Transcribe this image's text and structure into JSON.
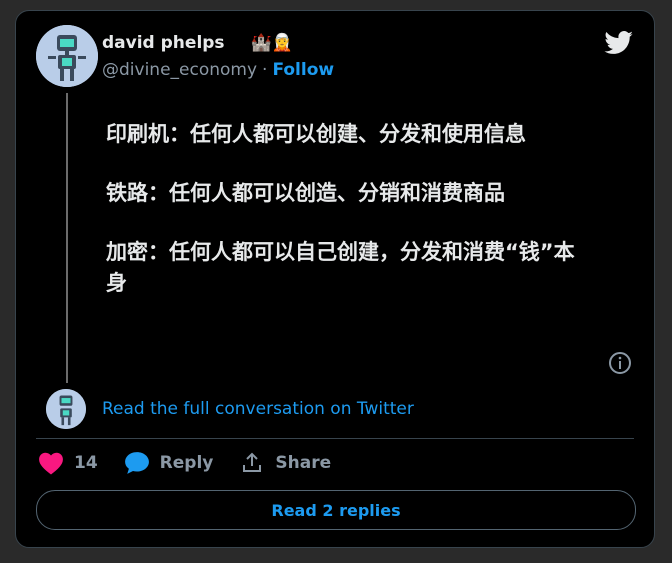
{
  "author": {
    "name": "david phelps",
    "emojis": "🐮🏰🧝",
    "handle": "@divine_economy",
    "separator": "·",
    "follow_label": "Follow"
  },
  "tweet": {
    "paragraphs": [
      "印刷机：任何人都可以创建、分发和使用信息",
      "铁路：任何人都可以创造、分销和消费商品",
      "加密：任何人都可以自己创建，分发和消费“钱”本身"
    ]
  },
  "read_conversation_label": "Read the full conversation on Twitter",
  "actions": {
    "likes_count": "14",
    "reply_label": "Reply",
    "share_label": "Share"
  },
  "read_replies_label": "Read 2 replies",
  "colors": {
    "accent": "#1d9bf0",
    "like": "#f91880",
    "background": "#000000",
    "border": "#38444d"
  }
}
